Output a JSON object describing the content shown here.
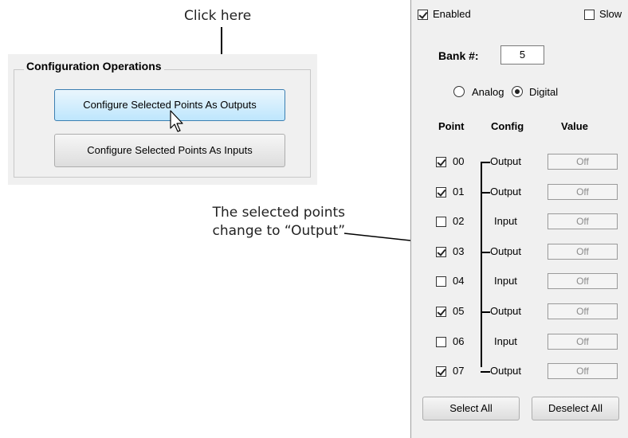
{
  "annotations": {
    "click_here": "Click here",
    "selected_line1": "The selected points",
    "selected_line2": "change to “Output”"
  },
  "config_ops": {
    "title": "Configuration Operations",
    "btn_outputs": "Configure Selected Points As Outputs",
    "btn_inputs": "Configure Selected Points As Inputs"
  },
  "panel": {
    "enabled_label": "Enabled",
    "enabled_checked": true,
    "slow_label": "Slow",
    "slow_checked": false,
    "bank_label": "Bank #:",
    "bank_value": "5",
    "analog_label": "Analog",
    "digital_label": "Digital",
    "selected_mode": "Digital",
    "col_point": "Point",
    "col_config": "Config",
    "col_value": "Value",
    "points": [
      {
        "id": "00",
        "checked": true,
        "config": "Output",
        "value": "Off"
      },
      {
        "id": "01",
        "checked": true,
        "config": "Output",
        "value": "Off"
      },
      {
        "id": "02",
        "checked": false,
        "config": "Input",
        "value": "Off"
      },
      {
        "id": "03",
        "checked": true,
        "config": "Output",
        "value": "Off"
      },
      {
        "id": "04",
        "checked": false,
        "config": "Input",
        "value": "Off"
      },
      {
        "id": "05",
        "checked": true,
        "config": "Output",
        "value": "Off"
      },
      {
        "id": "06",
        "checked": false,
        "config": "Input",
        "value": "Off"
      },
      {
        "id": "07",
        "checked": true,
        "config": "Output",
        "value": "Off"
      }
    ],
    "select_all": "Select All",
    "deselect_all": "Deselect All"
  }
}
